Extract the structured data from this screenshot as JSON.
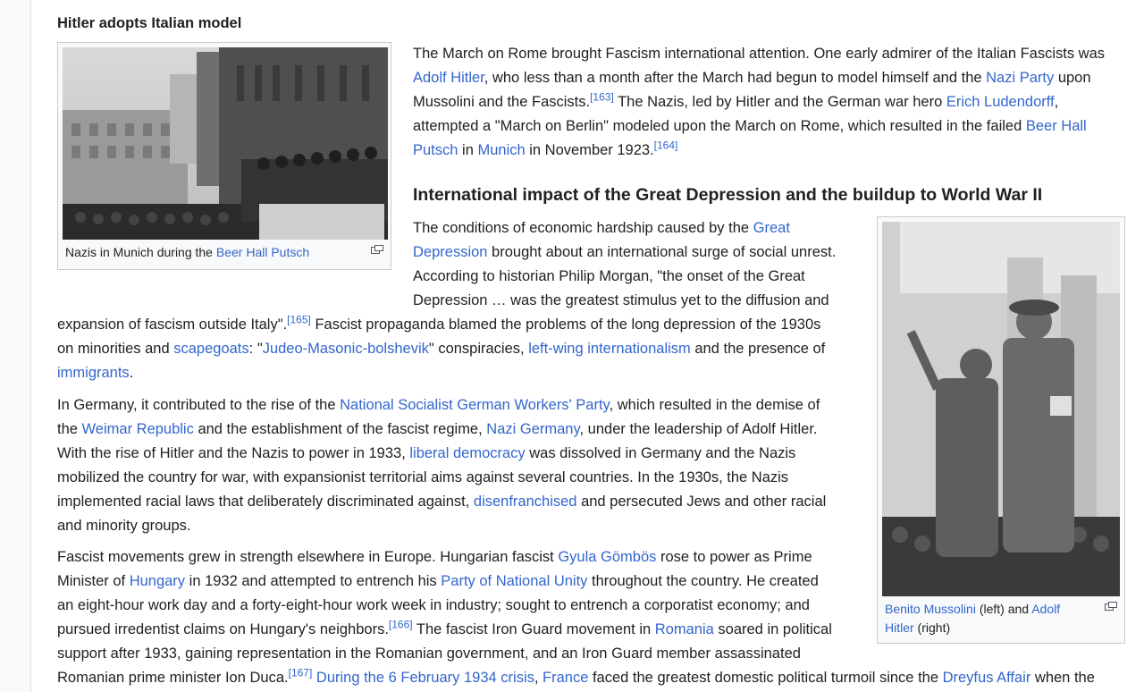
{
  "headings": {
    "h3": "Hitler adopts Italian model",
    "h2": "International impact of the Great Depression and the buildup to World War II"
  },
  "figures": {
    "munich": {
      "caption_prefix": "Nazis in Munich during the ",
      "caption_link": "Beer Hall Putsch"
    },
    "duce": {
      "caption_link1": "Benito Mussolini",
      "caption_mid": " (left) and ",
      "caption_link2a": "Adolf",
      "caption_link2b": "Hitler",
      "caption_end": " (right)"
    }
  },
  "p1": {
    "l1": "The March on Rome brought Fascism international attention. One early admirer of the Italian Fascists was",
    "l2_link1": "Adolf Hitler",
    "l2_t1": ", who less than a month after the March had begun to model himself and the ",
    "l2_link2": "Nazi Party",
    "l2_t2": " upon",
    "l3_t1": "Mussolini and the Fascists.",
    "l3_ref": "[163]",
    "l3_t2": " The Nazis, led by Hitler and the German war hero ",
    "l3_link": "Erich Ludendorff",
    "l3_t3": ",",
    "l4_t1": "attempted a \"March on Berlin\" modeled upon the March on Rome, which resulted in the failed ",
    "l4_link": "Beer Hall",
    "l5_link1": "Putsch",
    "l5_t1": " in ",
    "l5_link2": "Munich",
    "l5_t2": " in November 1923.",
    "l5_ref": "[164]"
  },
  "p2": {
    "l1_t1": "The conditions of economic hardship caused by the ",
    "l1_link": "Great",
    "l2_link": "Depression",
    "l2_t1": " brought about an international surge of social unrest.",
    "l3": "According to historian Philip Morgan, \"the onset of the Great",
    "l4": "Depression … was the greatest stimulus yet to the diffusion and",
    "l5_t1": "expansion of fascism outside Italy\".",
    "l5_ref": "[165]",
    "l5_t2": " Fascist propaganda blamed the problems of the long depression of the 1930s",
    "l6_t1": "on minorities and ",
    "l6_link1": "scapegoats",
    "l6_t2": ": \"",
    "l6_link2": "Judeo-Masonic-bolshevik",
    "l6_t3": "\" conspiracies, ",
    "l6_link3": "left-wing internationalism",
    "l6_t4": " and the presence of",
    "l7_link": "immigrants",
    "l7_t1": "."
  },
  "p3": {
    "l1_t1": "In Germany, it contributed to the rise of the ",
    "l1_link": "National Socialist German Workers' Party",
    "l1_t2": ", which resulted in the demise of",
    "l2_t1": "the ",
    "l2_link1": "Weimar Republic",
    "l2_t2": " and the establishment of the fascist regime, ",
    "l2_link2": "Nazi Germany",
    "l2_t3": ", under the leadership of Adolf Hitler.",
    "l3_t1": "With the rise of Hitler and the Nazis to power in 1933, ",
    "l3_link": "liberal democracy",
    "l3_t2": " was dissolved in Germany and the Nazis",
    "l4": "mobilized the country for war, with expansionist territorial aims against several countries. In the 1930s, the Nazis",
    "l5_t1": "implemented racial laws that deliberately discriminated against, ",
    "l5_link": "disenfranchised",
    "l5_t2": " and persecuted Jews and other racial",
    "l6": "and minority groups."
  },
  "p4": {
    "l1_t1": "Fascist movements grew in strength elsewhere in Europe. Hungarian fascist ",
    "l1_link": "Gyula Gömbös",
    "l1_t2": " rose to power as Prime",
    "l2_t1": "Minister of ",
    "l2_link1": "Hungary",
    "l2_t2": " in 1932 and attempted to entrench his ",
    "l2_link2": "Party of National Unity",
    "l2_t3": " throughout the country. He created",
    "l3": "an eight-hour work day and a forty-eight-hour work week in industry; sought to entrench a corporatist economy; and",
    "l4_t1": "pursued irredentist claims on Hungary's neighbors.",
    "l4_ref": "[166]",
    "l4_t2": " The fascist Iron Guard movement in ",
    "l4_link": "Romania",
    "l4_t3": " soared in political",
    "l5": "support after 1933, gaining representation in the Romanian government, and an Iron Guard member assassinated",
    "l6_t1": "Romanian prime minister Ion Duca.",
    "l6_ref": "[167]",
    "l6_t2": " ",
    "l6_link1": "During the 6 February 1934 crisis",
    "l6_t3": ", ",
    "l6_link2": "France",
    "l6_t4": " faced the greatest domestic political turmoil since the ",
    "l6_link3": "Dreyfus Affair",
    "l6_t5": " when the"
  },
  "colors": {
    "link": "#3366cc",
    "text": "#202122",
    "border": "#c8ccd1",
    "thumb_bg": "#f8f9fa"
  }
}
